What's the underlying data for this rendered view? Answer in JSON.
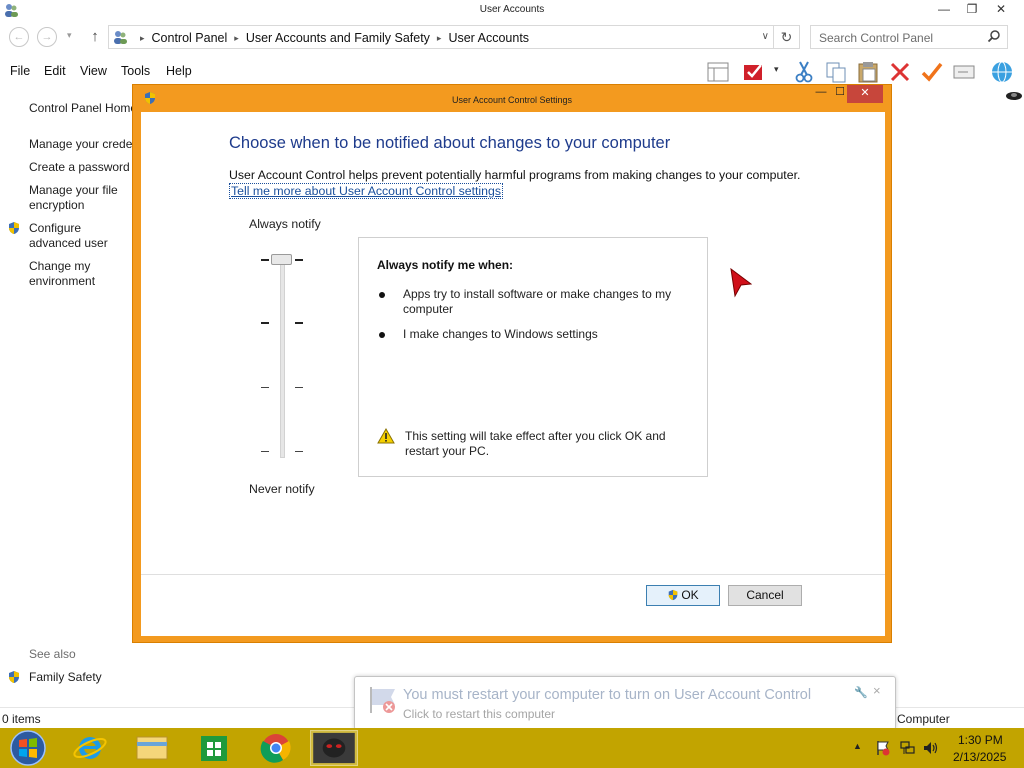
{
  "window": {
    "title": "User Accounts",
    "minimize_glyph": "—",
    "maximize_glyph": "❐",
    "close_glyph": "✕"
  },
  "nav": {
    "back_glyph": "←",
    "forward_glyph": "→",
    "recent_glyph": "▾",
    "up_glyph": "↑",
    "breadcrumb": [
      "Control Panel",
      "User Accounts and Family Safety",
      "User Accounts"
    ],
    "breadcrumb_separator": "▸",
    "dropdown_glyph": "∨",
    "refresh_glyph": "↻",
    "search_placeholder": "Search Control Panel"
  },
  "menu": {
    "items": [
      "File",
      "Edit",
      "View",
      "Tools",
      "Help"
    ]
  },
  "toolbar": {
    "icons": [
      "layout-icon",
      "checkmark-flag-icon",
      "dropdown-arrow-icon",
      "scissors-icon",
      "copy-icon",
      "paste-icon",
      "delete-x-icon",
      "check-icon",
      "rename-icon",
      "globe-icon"
    ],
    "dropdown_glyph": "▾"
  },
  "sidebar": {
    "home": "Control Panel Home",
    "links": [
      "Manage your credentials",
      "Create a password reset disk",
      "Manage your file encryption certificates",
      "Configure advanced user profile properties",
      "Change my environment variables"
    ],
    "see_also": "See also",
    "family_safety": "Family Safety"
  },
  "status": {
    "items_count": "0 items",
    "location": "Computer"
  },
  "dialog": {
    "title": "User Account Control Settings",
    "minimize_glyph": "—",
    "maximize_glyph": "☐",
    "close_glyph": "✕",
    "heading": "Choose when to be notified about changes to your computer",
    "description": "User Account Control helps prevent potentially harmful programs from making changes to your computer.",
    "learn_more": "Tell me more about User Account Control settings",
    "slider_top_label": "Always notify",
    "slider_bottom_label": "Never notify",
    "slider_level": 4,
    "slider_levels": 4,
    "info_title": "Always notify me when:",
    "info_bullets": [
      "Apps try to install software or make changes to my computer",
      "I make changes to Windows settings"
    ],
    "warning": "This setting will take effect after you click OK and restart your PC.",
    "ok": "OK",
    "cancel": "Cancel"
  },
  "notification": {
    "title": "You must restart your computer to turn on User Account Control",
    "subtitle": "Click to restart this computer",
    "wrench_glyph": "🔧",
    "close_glyph": "×"
  },
  "taskbar": {
    "apps": [
      "internet-explorer",
      "file-explorer",
      "windows-store",
      "chrome",
      "app-mask"
    ],
    "tray_up_glyph": "▲",
    "time": "1:30 PM",
    "date": "2/13/2025"
  },
  "colors": {
    "dialog_frame": "#f39a1f",
    "taskbar": "#c2a400",
    "heading_blue": "#1e3b8c",
    "close_red": "#c7463b"
  }
}
